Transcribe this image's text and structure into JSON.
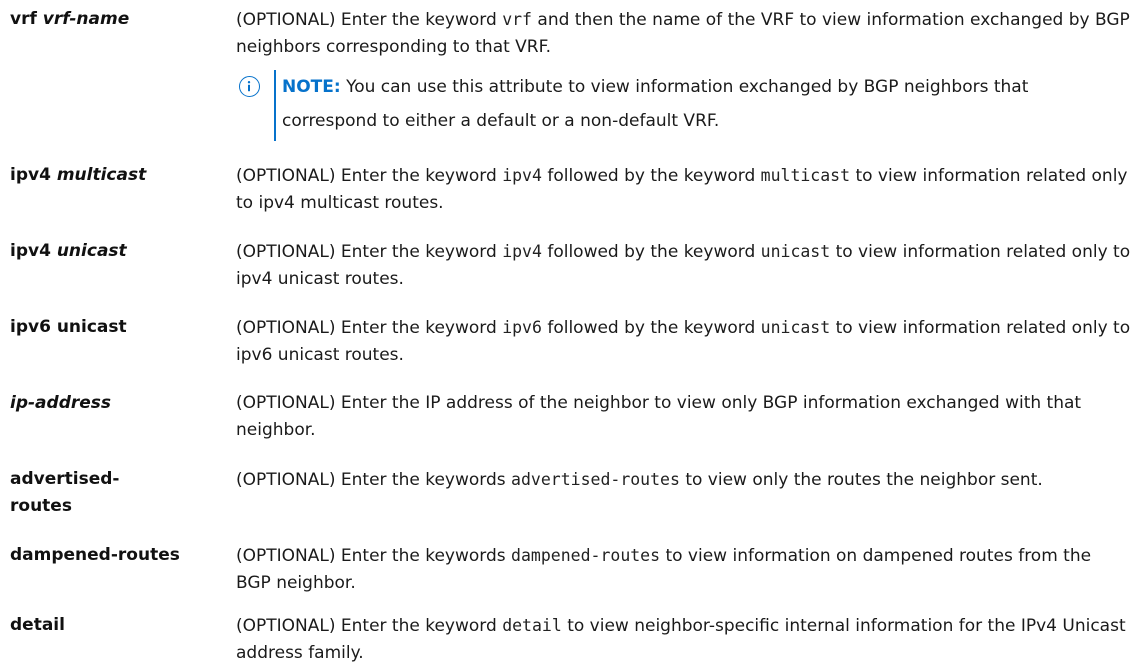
{
  "rows": [
    {
      "term": {
        "bold": "vrf",
        "italic": "vrf-name"
      },
      "desc": {
        "t1": "(OPTIONAL) Enter the keyword ",
        "c1": "vrf",
        "t2": " and then the name of the VRF to view information exchanged by BGP neighbors corresponding to that VRF."
      },
      "note": {
        "label": "NOTE:",
        "text": " You can use this attribute to view information exchanged by BGP neighbors that correspond to either a default or a non-default VRF."
      }
    },
    {
      "term": {
        "bold": "ipv4",
        "italic": "multicast"
      },
      "desc": {
        "t1": "(OPTIONAL) Enter the keyword ",
        "c1": "ipv4",
        "t2": " followed by the keyword ",
        "c2": "multicast",
        "t3": " to view information related only to ipv4 multicast routes."
      }
    },
    {
      "term": {
        "bold": "ipv4",
        "italic": "unicast"
      },
      "desc": {
        "t1": "(OPTIONAL) Enter the keyword ",
        "c1": "ipv4",
        "t2": " followed by the keyword ",
        "c2": "unicast",
        "t3": " to view information related only to ipv4 unicast routes."
      }
    },
    {
      "term": {
        "bold": "ipv6 unicast"
      },
      "desc": {
        "t1": "(OPTIONAL) Enter the keyword ",
        "c1": "ipv6",
        "t2": " followed by the keyword ",
        "c2": "unicast",
        "t3": " to view information related only to ipv6 unicast routes."
      }
    },
    {
      "term": {
        "italic": "ip-address"
      },
      "desc": {
        "t1": "(OPTIONAL) Enter the IP address of the neighbor to view only BGP information exchanged with that neighbor."
      }
    },
    {
      "term": {
        "bold_line1": "advertised-",
        "bold_line2": "routes"
      },
      "desc": {
        "t1": "(OPTIONAL) Enter the keywords ",
        "c1": "advertised-routes",
        "t2": " to view only the routes the neighbor sent."
      }
    },
    {
      "term": {
        "bold": "dampened-routes"
      },
      "desc": {
        "t1": "(OPTIONAL) Enter the keywords ",
        "c1": "dampened-routes",
        "t2": " to view information on dampened routes from the BGP neighbor."
      }
    },
    {
      "term": {
        "bold": "detail"
      },
      "desc": {
        "t1": "(OPTIONAL) Enter the keyword ",
        "c1": "detail",
        "t2": " to view neighbor-specific internal information for the IPv4 Unicast address family."
      }
    }
  ],
  "colors": {
    "note_accent": "#0672cb",
    "text": "#1a1a1a"
  },
  "icons": {
    "note": "info-icon"
  }
}
